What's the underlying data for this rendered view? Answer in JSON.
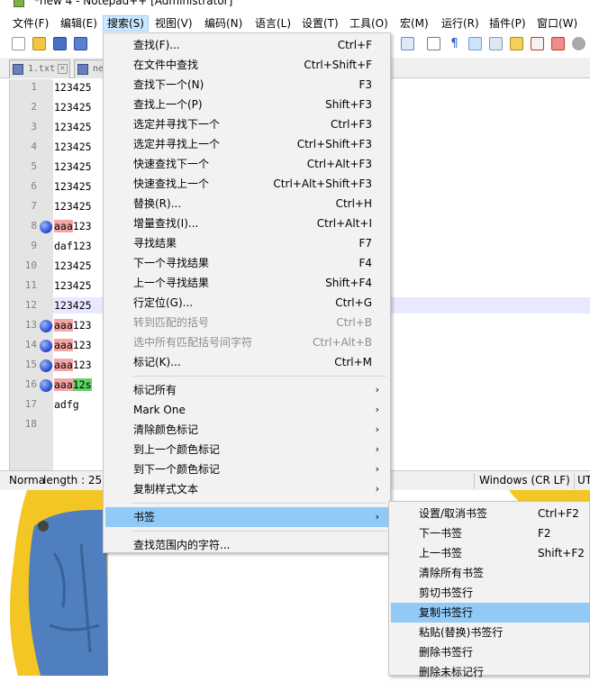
{
  "window": {
    "title": "*new 4 - Notepad++ [Administrator]"
  },
  "menubar": {
    "items": [
      "文件(F)",
      "编辑(E)",
      "搜索(S)",
      "视图(V)",
      "编码(N)",
      "语言(L)",
      "设置(T)",
      "工具(O)",
      "宏(M)",
      "运行(R)",
      "插件(P)",
      "窗口(W)"
    ]
  },
  "tabs": [
    {
      "label": "1.txt",
      "close": "✕"
    },
    {
      "label": "ne"
    }
  ],
  "editor": {
    "line_numbers": [
      "1",
      "2",
      "3",
      "4",
      "5",
      "6",
      "7",
      "8",
      "9",
      "10",
      "11",
      "12",
      "13",
      "14",
      "15",
      "16",
      "17",
      "18"
    ],
    "lines": [
      {
        "pre": "",
        "mark": "",
        "post": "123425"
      },
      {
        "pre": "",
        "mark": "",
        "post": "123425"
      },
      {
        "pre": "",
        "mark": "",
        "post": "123425"
      },
      {
        "pre": "",
        "mark": "",
        "post": "123425"
      },
      {
        "pre": "",
        "mark": "",
        "post": "123425"
      },
      {
        "pre": "",
        "mark": "",
        "post": "123425"
      },
      {
        "pre": "",
        "mark": "",
        "post": "123425"
      },
      {
        "pre": "",
        "mark": "aaa",
        "post": "123"
      },
      {
        "pre": "",
        "mark": "",
        "post": "daf123"
      },
      {
        "pre": "",
        "mark": "",
        "post": "123425"
      },
      {
        "pre": "",
        "mark": "",
        "post": "123425"
      },
      {
        "pre": "",
        "mark": "",
        "post": "123425"
      },
      {
        "pre": "",
        "mark": "aaa",
        "post": "123"
      },
      {
        "pre": "",
        "mark": "aaa",
        "post": "123"
      },
      {
        "pre": "",
        "mark": "aaa",
        "post": "123"
      },
      {
        "pre": "",
        "mark": "aaa",
        "post": "12s"
      },
      {
        "pre": "",
        "mark": "",
        "post": "adfg"
      },
      {
        "pre": "",
        "mark": "",
        "post": ""
      }
    ],
    "bookmarked_lines": [
      8,
      13,
      14,
      15,
      16
    ]
  },
  "statusbar": {
    "type": "Norma",
    "length": "length : 25",
    "eol": "Windows (CR LF)",
    "encoding": "UT"
  },
  "search_menu": {
    "items": [
      {
        "label": "查找(F)...",
        "shortcut": "Ctrl+F"
      },
      {
        "label": "在文件中查找",
        "shortcut": "Ctrl+Shift+F"
      },
      {
        "label": "查找下一个(N)",
        "shortcut": "F3"
      },
      {
        "label": "查找上一个(P)",
        "shortcut": "Shift+F3"
      },
      {
        "label": "选定并寻找下一个",
        "shortcut": "Ctrl+F3"
      },
      {
        "label": "选定并寻找上一个",
        "shortcut": "Ctrl+Shift+F3"
      },
      {
        "label": "快速查找下一个",
        "shortcut": "Ctrl+Alt+F3"
      },
      {
        "label": "快速查找上一个",
        "shortcut": "Ctrl+Alt+Shift+F3"
      },
      {
        "label": "替换(R)...",
        "shortcut": "Ctrl+H"
      },
      {
        "label": "增量查找(I)...",
        "shortcut": "Ctrl+Alt+I"
      },
      {
        "label": "寻找结果",
        "shortcut": "F7"
      },
      {
        "label": "下一个寻找结果",
        "shortcut": "F4"
      },
      {
        "label": "上一个寻找结果",
        "shortcut": "Shift+F4"
      },
      {
        "label": "行定位(G)...",
        "shortcut": "Ctrl+G"
      },
      {
        "label": "转到匹配的括号",
        "shortcut": "Ctrl+B",
        "disabled": true
      },
      {
        "label": "选中所有匹配括号间字符",
        "shortcut": "Ctrl+Alt+B",
        "disabled": true
      },
      {
        "label": "标记(K)...",
        "shortcut": "Ctrl+M"
      },
      {
        "label": "标记所有",
        "submenu": true
      },
      {
        "label": "Mark One",
        "submenu": true
      },
      {
        "label": "清除颜色标记",
        "submenu": true
      },
      {
        "label": "到上一个颜色标记",
        "submenu": true
      },
      {
        "label": "到下一个颜色标记",
        "submenu": true
      },
      {
        "label": "复制样式文本",
        "submenu": true
      },
      {
        "label": "书签",
        "submenu": true,
        "highlighted": true
      },
      {
        "label": "查找范围内的字符..."
      }
    ],
    "arrow": "›"
  },
  "bookmark_submenu": {
    "items": [
      {
        "label": "设置/取消书签",
        "shortcut": "Ctrl+F2"
      },
      {
        "label": "下一书签",
        "shortcut": "F2"
      },
      {
        "label": "上一书签",
        "shortcut": "Shift+F2"
      },
      {
        "label": "清除所有书签"
      },
      {
        "label": "剪切书签行"
      },
      {
        "label": "复制书签行",
        "highlighted": true
      },
      {
        "label": "粘贴(替换)书签行"
      },
      {
        "label": "删除书签行"
      },
      {
        "label": "删除未标记行"
      }
    ]
  },
  "colors": {
    "menu_highlight": "#91c9f7",
    "active_menu": "#cce8ff",
    "find_mark": "#f4a6a6",
    "selection_mark": "#66d166",
    "bookmark": "#2447c9"
  }
}
